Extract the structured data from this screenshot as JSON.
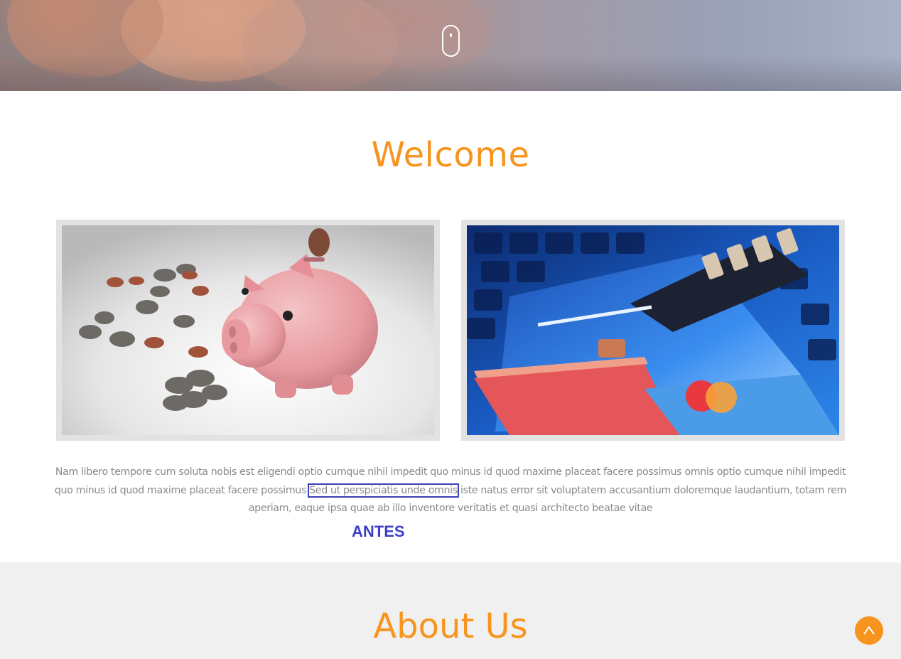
{
  "hero": {
    "scroll_icon": "mouse-scroll-icon"
  },
  "welcome": {
    "title": "Welcome",
    "images": [
      {
        "name": "piggy-bank-image"
      },
      {
        "name": "credit-cards-lock-image"
      }
    ],
    "text_before": "Nam libero tempore cum soluta nobis est eligendi optio cumque nihil impedit quo minus id quod maxime placeat facere possimus omnis optio cumque nihil impedit quo minus id quod maxime placeat facere possimus ",
    "text_highlight": "Sed ut perspiciatis unde omnis",
    "text_after": " iste natus error sit voluptatem accusantium doloremque laudantium, totam rem aperiam, eaque ipsa quae ab illo inventore veritatis et quasi architecto beatae vitae",
    "annotation": "ANTES"
  },
  "about": {
    "title": "About Us"
  },
  "back_to_top": {
    "icon": "chevron-up-icon"
  },
  "colors": {
    "accent": "#f7941d",
    "annotation": "#3b3fc8",
    "body_text": "#8a8a8a"
  }
}
